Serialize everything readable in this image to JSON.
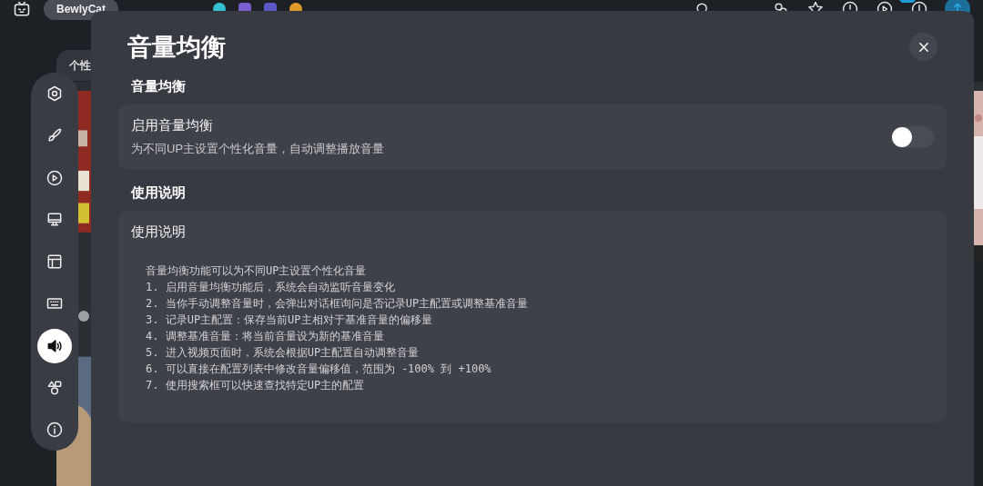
{
  "top_bar": {
    "tabs": [
      {
        "label": "BewlyCat",
        "selected": true
      }
    ]
  },
  "side_tab": {
    "label": "个性"
  },
  "dock": {
    "items": [
      {
        "selected": false
      },
      {
        "selected": false
      },
      {
        "selected": false
      },
      {
        "selected": false
      },
      {
        "selected": false
      },
      {
        "selected": false
      },
      {
        "selected": true
      },
      {
        "selected": false
      },
      {
        "selected": false
      }
    ]
  },
  "dialog": {
    "title": "音量均衡",
    "sections": [
      {
        "heading": "音量均衡",
        "kind": "toggle",
        "title": "启用音量均衡",
        "description": "为不同UP主设置个性化音量，自动调整播放音量",
        "on": false
      },
      {
        "heading": "使用说明",
        "kind": "text",
        "title": "使用说明",
        "lines": [
          "音量均衡功能可以为不同UP主设置个性化音量",
          "1. 启用音量均衡功能后，系统会自动监听音量变化",
          "2. 当你手动调整音量时，会弹出对话框询问是否记录UP主配置或调整基准音量",
          "3. 记录UP主配置：保存当前UP主相对于基准音量的偏移量",
          "4. 调整基准音量：将当前音量设为新的基准音量",
          "5. 进入视频页面时，系统会根据UP主配置自动调整音量",
          "6. 可以直接在配置列表中修改音量偏移值，范围为 -100% 到 +100%",
          "7. 使用搜索框可以快速查找特定UP主的配置"
        ]
      }
    ]
  }
}
